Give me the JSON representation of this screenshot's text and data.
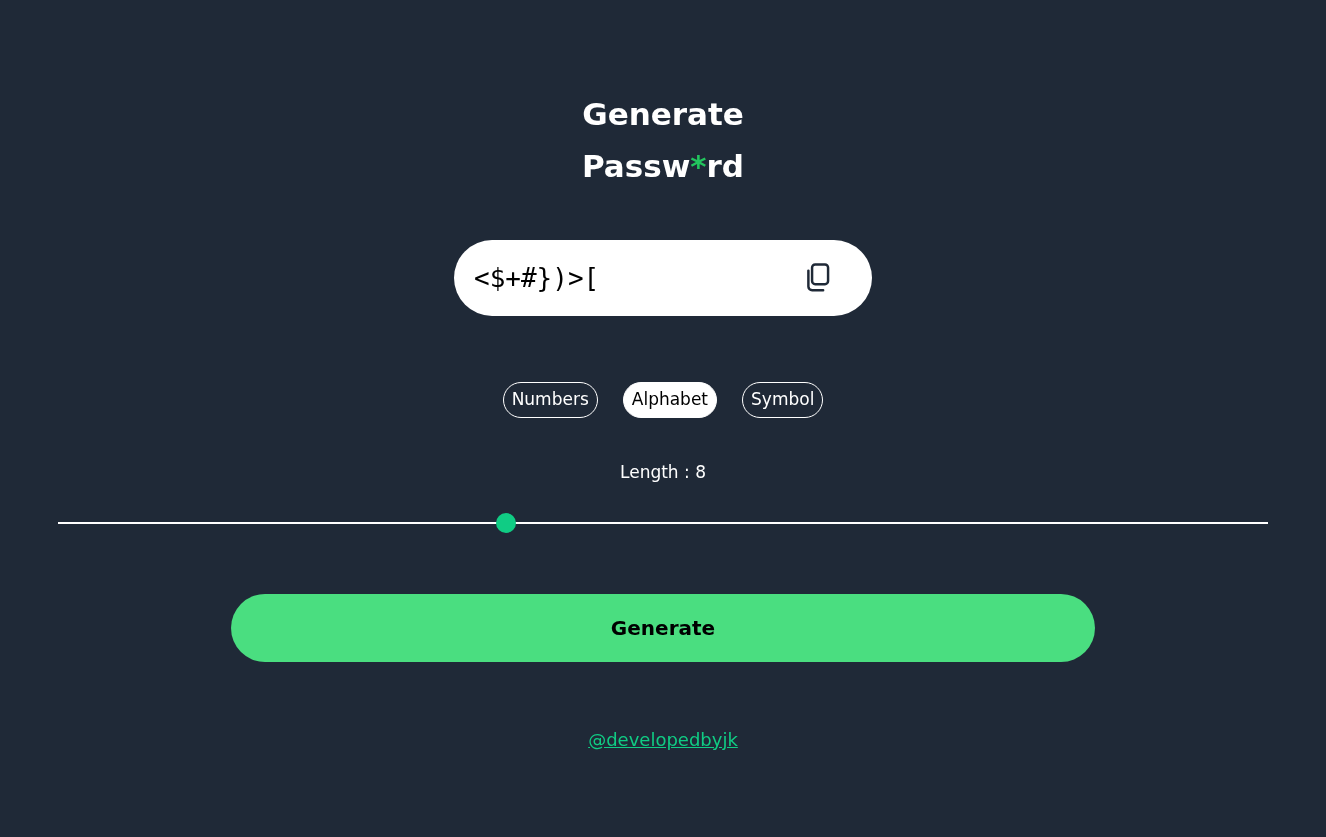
{
  "title": {
    "lines": [
      [
        {
          "text": "Generate",
          "accent": false
        }
      ],
      [
        {
          "text": "Passw",
          "accent": false
        },
        {
          "text": "*",
          "accent": true
        },
        {
          "text": "rd",
          "accent": false
        }
      ]
    ]
  },
  "password": {
    "value": "<$+#})>["
  },
  "options": [
    {
      "label": "Numbers",
      "selected": false
    },
    {
      "label": "Alphabet",
      "selected": true
    },
    {
      "label": "Symbol",
      "selected": false
    }
  ],
  "length": {
    "label": "Length : 8",
    "level": 0.37
  },
  "generate_button": "Generate",
  "credit_link": "@developedbyjk"
}
